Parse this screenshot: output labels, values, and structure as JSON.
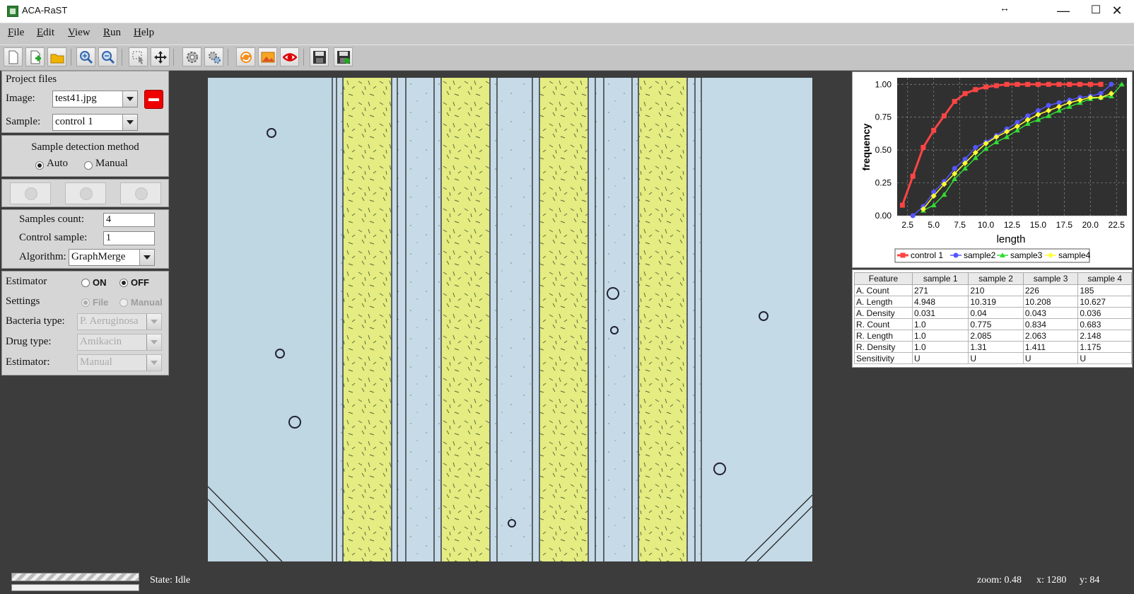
{
  "window": {
    "title": "ACA-RaST",
    "resize_glyph": "↔",
    "minimize": "—",
    "maximize": "☐",
    "close": "✕"
  },
  "menu": [
    "File",
    "Edit",
    "View",
    "Run",
    "Help"
  ],
  "toolbar_icons": [
    "new-file-icon",
    "add-file-icon",
    "open-folder-icon",
    "zoom-in-icon",
    "zoom-out-icon",
    "select-tool-icon",
    "move-tool-icon",
    "settings-icon",
    "settings-advanced-icon",
    "refresh-icon",
    "image-icon",
    "eye-icon",
    "save-icon",
    "save-as-icon"
  ],
  "project": {
    "title": "Project files",
    "image_label": "Image:",
    "image_value": "test41.jpg",
    "sample_label": "Sample:",
    "sample_value": "control 1"
  },
  "detection": {
    "title": "Sample detection method",
    "auto": "Auto",
    "manual": "Manual",
    "selected": "Auto"
  },
  "params": {
    "samples_count_label": "Samples count:",
    "samples_count": "4",
    "control_sample_label": "Control sample:",
    "control_sample": "1",
    "algorithm_label": "Algorithm:",
    "algorithm": "GraphMerge"
  },
  "estimator": {
    "label": "Estimator",
    "on": "ON",
    "off": "OFF",
    "selected": "OFF",
    "settings_label": "Settings",
    "file": "File",
    "manual": "Manual",
    "bacteria_label": "Bacteria type:",
    "bacteria_value": "P. Aeruginosa",
    "drug_label": "Drug type:",
    "drug_value": "Amikacin",
    "estimator2_label": "Estimator:",
    "estimator2_value": "Manual"
  },
  "chart_data": {
    "type": "line",
    "xlabel": "length",
    "ylabel": "frequency",
    "xlim": [
      1.5,
      23.5
    ],
    "ylim": [
      0,
      1.05
    ],
    "xticks": [
      "2.5",
      "5.0",
      "7.5",
      "10.0",
      "12.5",
      "15.0",
      "17.5",
      "20.0",
      "22.5"
    ],
    "yticks": [
      "0.00",
      "0.25",
      "0.50",
      "0.75",
      "1.00"
    ],
    "grid": true,
    "background": "#303030",
    "series": [
      {
        "name": "control 1",
        "color": "#ff4444",
        "marker": "square",
        "x": [
          2,
          3,
          4,
          5,
          6,
          7,
          8,
          9,
          10,
          11,
          12,
          13,
          14,
          15,
          16,
          17,
          18,
          19,
          20,
          21
        ],
        "y": [
          0.08,
          0.3,
          0.52,
          0.65,
          0.76,
          0.87,
          0.93,
          0.96,
          0.98,
          0.99,
          1.0,
          1.0,
          1.0,
          1.0,
          1.0,
          1.0,
          1.0,
          1.0,
          1.0,
          1.0
        ]
      },
      {
        "name": "sample2",
        "color": "#5555ff",
        "marker": "circle",
        "x": [
          3,
          4,
          5,
          6,
          7,
          8,
          9,
          10,
          11,
          12,
          13,
          14,
          15,
          16,
          17,
          18,
          19,
          20,
          21,
          22
        ],
        "y": [
          0.0,
          0.07,
          0.18,
          0.26,
          0.36,
          0.43,
          0.52,
          0.56,
          0.61,
          0.66,
          0.71,
          0.76,
          0.8,
          0.84,
          0.86,
          0.88,
          0.9,
          0.91,
          0.93,
          1.0
        ]
      },
      {
        "name": "sample3",
        "color": "#33dd33",
        "marker": "triangle",
        "x": [
          4,
          5,
          6,
          7,
          8,
          9,
          10,
          11,
          12,
          13,
          14,
          15,
          16,
          17,
          18,
          19,
          20,
          21,
          22,
          23
        ],
        "y": [
          0.04,
          0.08,
          0.16,
          0.28,
          0.36,
          0.44,
          0.51,
          0.56,
          0.6,
          0.65,
          0.7,
          0.73,
          0.76,
          0.8,
          0.83,
          0.86,
          0.89,
          0.9,
          0.91,
          1.0
        ]
      },
      {
        "name": "sample4",
        "color": "#ffff33",
        "marker": "diamond",
        "x": [
          4,
          5,
          6,
          7,
          8,
          9,
          10,
          11,
          12,
          13,
          14,
          15,
          16,
          17,
          18,
          19,
          20,
          21,
          22
        ],
        "y": [
          0.05,
          0.15,
          0.24,
          0.32,
          0.4,
          0.48,
          0.55,
          0.6,
          0.64,
          0.68,
          0.73,
          0.77,
          0.8,
          0.83,
          0.86,
          0.88,
          0.9,
          0.9,
          0.93
        ]
      }
    ]
  },
  "feature_table": {
    "headers": [
      "Feature",
      "sample 1",
      "sample 2",
      "sample 3",
      "sample 4"
    ],
    "rows": [
      [
        "A. Count",
        "271",
        "210",
        "226",
        "185"
      ],
      [
        "A. Length",
        "4.948",
        "10.319",
        "10.208",
        "10.627"
      ],
      [
        "A. Density",
        "0.031",
        "0.04",
        "0.043",
        "0.036"
      ],
      [
        "R. Count",
        "1.0",
        "0.775",
        "0.834",
        "0.683"
      ],
      [
        "R. Length",
        "1.0",
        "2.085",
        "2.063",
        "2.148"
      ],
      [
        "R. Density",
        "1.0",
        "1.31",
        "1.411",
        "1.175"
      ],
      [
        "Sensitivity",
        "U",
        "U",
        "U",
        "U"
      ]
    ]
  },
  "status": {
    "state": "State:  Idle",
    "zoom": "zoom:  0.48",
    "x": "x:  1280",
    "y": "y:  84"
  }
}
